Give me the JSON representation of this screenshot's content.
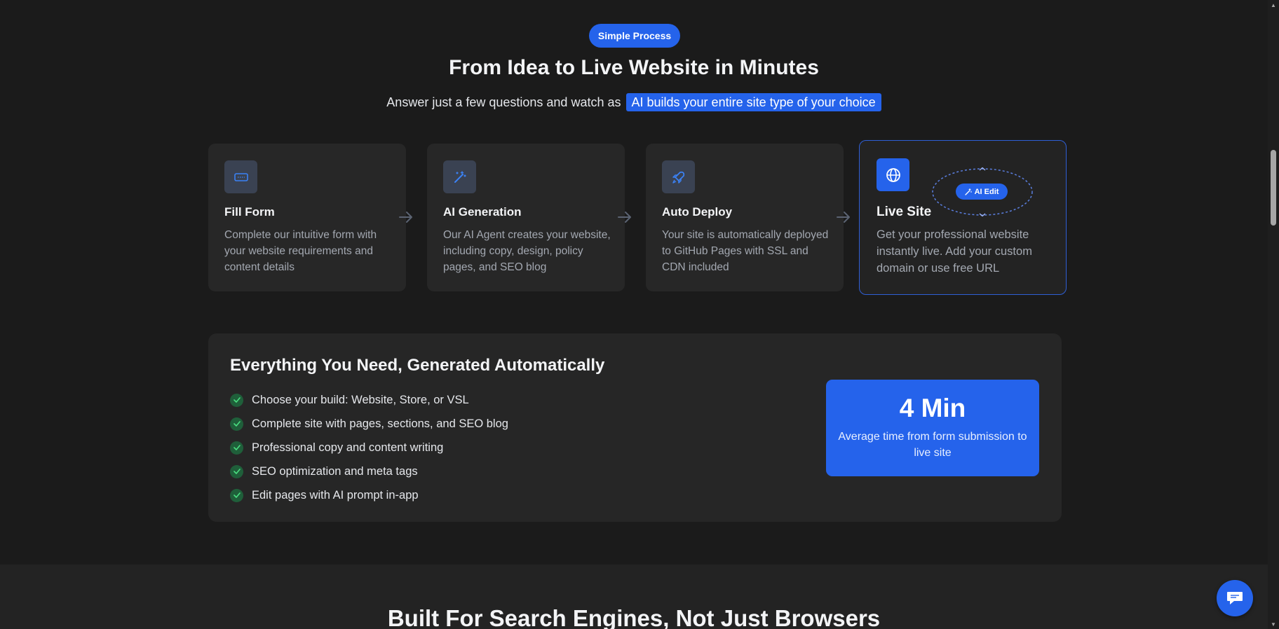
{
  "process": {
    "badge": "Simple Process",
    "title": "From Idea to Live Website in Minutes",
    "subtitle_prefix": "Answer just a few questions and watch as",
    "subtitle_highlight": "AI builds your entire site type of your choice"
  },
  "steps": [
    {
      "icon": "form-icon",
      "title": "Fill Form",
      "description": "Complete our intuitive form with your website requirements and content details"
    },
    {
      "icon": "magic-wand-icon",
      "title": "AI Generation",
      "description": "Our AI Agent creates your website, including copy, design, policy pages, and SEO blog"
    },
    {
      "icon": "rocket-icon",
      "title": "Auto Deploy",
      "description": "Your site is automatically deployed to GitHub Pages with SSL and CDN included"
    },
    {
      "icon": "globe-icon",
      "title": "Live Site",
      "description": "Get your professional website instantly live. Add your custom domain or use free URL",
      "pill": "AI Edit"
    }
  ],
  "features": {
    "title": "Everything You Need, Generated Automatically",
    "items": [
      "Choose your build: Website, Store, or VSL",
      "Complete site with pages, sections, and SEO blog",
      "Professional copy and content writing",
      "SEO optimization and meta tags",
      "Edit pages with AI prompt in-app"
    ],
    "stat_value": "4 Min",
    "stat_label": "Average time from form submission to live site"
  },
  "next_section": {
    "title": "Built For Search Engines, Not Just Browsers"
  },
  "colors": {
    "accent": "#2563eb",
    "background": "#1b1b1b",
    "card": "#272727",
    "check": "#1f5f3a"
  }
}
